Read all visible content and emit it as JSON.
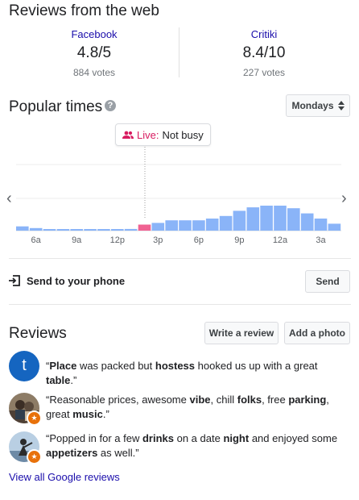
{
  "web_reviews": {
    "title": "Reviews from the web",
    "sources": [
      {
        "name": "Facebook",
        "rating": "4.8/5",
        "votes": "884 votes"
      },
      {
        "name": "Critiki",
        "rating": "8.4/10",
        "votes": "227 votes"
      }
    ]
  },
  "popular_times": {
    "title": "Popular times",
    "help_icon": "?",
    "day_select": "Mondays",
    "live_label": "Live:",
    "live_status": "Not busy",
    "hours": [
      {
        "label": "",
        "value": 5
      },
      {
        "label": "6a",
        "value": 3
      },
      {
        "label": "",
        "value": 1
      },
      {
        "label": "",
        "value": 1
      },
      {
        "label": "9a",
        "value": 1
      },
      {
        "label": "",
        "value": 1
      },
      {
        "label": "",
        "value": 1
      },
      {
        "label": "12p",
        "value": 1
      },
      {
        "label": "",
        "value": 2
      },
      {
        "label": "",
        "value": 7,
        "live": true
      },
      {
        "label": "3p",
        "value": 9
      },
      {
        "label": "",
        "value": 12
      },
      {
        "label": "",
        "value": 12
      },
      {
        "label": "6p",
        "value": 12
      },
      {
        "label": "",
        "value": 14
      },
      {
        "label": "",
        "value": 17
      },
      {
        "label": "9p",
        "value": 23
      },
      {
        "label": "",
        "value": 27
      },
      {
        "label": "",
        "value": 29
      },
      {
        "label": "12a",
        "value": 29
      },
      {
        "label": "",
        "value": 26
      },
      {
        "label": "",
        "value": 20
      },
      {
        "label": "3a",
        "value": 14
      },
      {
        "label": "",
        "value": 8
      }
    ],
    "colors": {
      "bar": "#8ab4f8",
      "live_bar": "#f06292"
    }
  },
  "send": {
    "label": "Send to your phone",
    "button": "Send"
  },
  "reviews": {
    "title": "Reviews",
    "write_button": "Write a review",
    "photo_button": "Add a photo",
    "items": [
      {
        "avatar_letter": "t",
        "parts": [
          [
            "“",
            false
          ],
          [
            "Place",
            true
          ],
          [
            " was packed but ",
            false
          ],
          [
            "hostess",
            true
          ],
          [
            " hooked us up with a great ",
            false
          ],
          [
            "table",
            true
          ],
          [
            ".”",
            false
          ]
        ]
      },
      {
        "avatar_letter": "",
        "parts": [
          [
            "“Reasonable prices, awesome ",
            false
          ],
          [
            "vibe",
            true
          ],
          [
            ", chill ",
            false
          ],
          [
            "folks",
            true
          ],
          [
            ", free ",
            false
          ],
          [
            "parking",
            true
          ],
          [
            ", great ",
            false
          ],
          [
            "music",
            true
          ],
          [
            ".”",
            false
          ]
        ]
      },
      {
        "avatar_letter": "",
        "parts": [
          [
            "“Popped in for a few ",
            false
          ],
          [
            "drinks",
            true
          ],
          [
            " on a date ",
            false
          ],
          [
            "night",
            true
          ],
          [
            " and enjoyed some ",
            false
          ],
          [
            "appetizers",
            true
          ],
          [
            " as well.”",
            false
          ]
        ]
      }
    ],
    "view_all": "View all Google reviews"
  }
}
